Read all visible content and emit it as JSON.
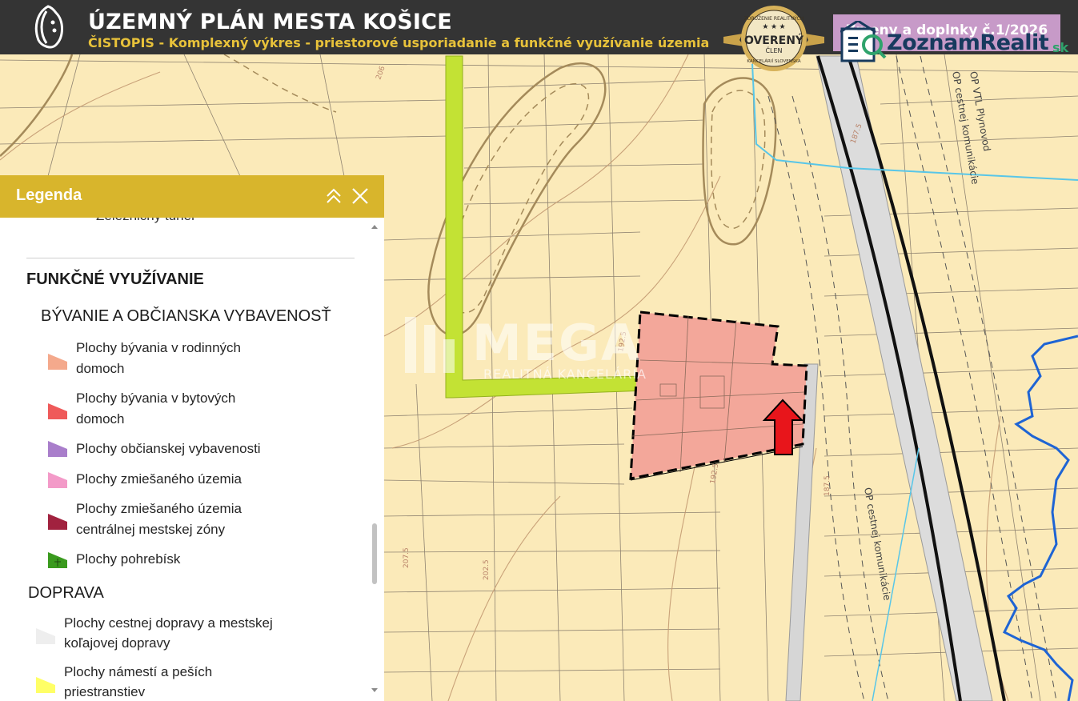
{
  "header": {
    "title": "ÚZEMNÝ PLÁN MESTA KOŠICE",
    "subtitle": "ČISTOPIS - Komplexný výkres - priestorové usporiadanie a funkčné využívanie územia",
    "changes_button": "Zmeny a doplnky č.1/2026"
  },
  "badge": {
    "top_arc": "ZDRUŽENIE REALITNÝCH",
    "main": "OVERENÝ",
    "sub": "ČLEN",
    "bottom_arc": "KANCELÁRIÍ SLOVENSKA"
  },
  "zoznam": {
    "name": "ZoznamRealit",
    "tld": "sk"
  },
  "watermark": {
    "name": "MEGA",
    "sub": "REALITNÁ KANCELÁRIA"
  },
  "map_labels": {
    "cesta_vertical": "OP cestnej komunikácie",
    "cesta_top": "OP cestnej komunikácie",
    "plynovod": "OP VTL Plynovod",
    "c1": "206",
    "c2": "187.5",
    "c3": "192.5",
    "c4": "207.5",
    "c5": "202.5",
    "c6": "187.5",
    "c7": "192.5"
  },
  "legend": {
    "title": "Legenda",
    "cut_item": "Zelezničný tunel",
    "section_functional": "FUNKČNÉ VYUŽÍVANIE",
    "section_housing": "BÝVANIE A OBČIANSKA VYBAVENOSŤ",
    "section_transport": "DOPRAVA",
    "items": [
      {
        "line1": "Plochy bývania v rodinných",
        "line2": "domoch",
        "color": "#f4a98c"
      },
      {
        "line1": "Plochy bývania v bytových",
        "line2": "domoch",
        "color": "#ef5a5a"
      },
      {
        "line1": "Plochy občianskej vybavenosti",
        "line2": "",
        "color": "#a97ecb"
      },
      {
        "line1": "Plochy zmiešaného územia",
        "line2": "",
        "color": "#f39ac8"
      },
      {
        "line1": "Plochy zmiešaného územia",
        "line2": "centrálnej mestskej zóny",
        "color": "#a1223f"
      },
      {
        "line1": "Plochy pohrebísk",
        "line2": "",
        "color": "#3a9a1e"
      }
    ],
    "transport_items": [
      {
        "line1": "Plochy cestnej dopravy a mestskej",
        "line2": "koľajovej dopravy",
        "color": "#eeeeee"
      },
      {
        "line1": "Plochy námestí a peších",
        "line2": "priestranstiev",
        "color": "#ffff66"
      }
    ]
  }
}
